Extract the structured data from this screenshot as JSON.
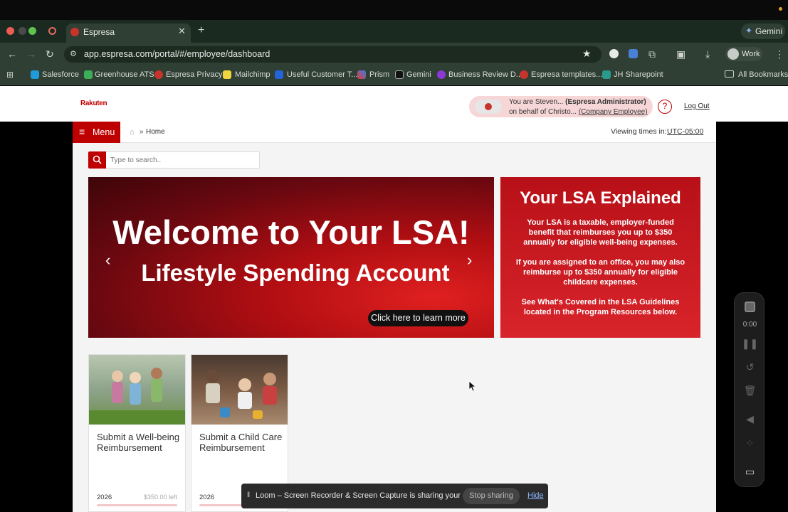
{
  "browser": {
    "tab_title": "Espresa",
    "new_tab": "+",
    "url": "app.espresa.com/portal/#/employee/dashboard",
    "gemini_label": "Gemini",
    "profile_label": "Work",
    "bookmarks": [
      "Salesforce",
      "Greenhouse ATS",
      "Espresa Privacy",
      "Mailchimp",
      "Useful Customer T...",
      "Prism",
      "Gemini",
      "Business Review D...",
      "Espresa templates...",
      "JH Sharepoint"
    ],
    "all_bookmarks": "All Bookmarks"
  },
  "header": {
    "logo": "Rakuten",
    "impersonation": {
      "line1_prefix": "You are Steven...",
      "line1_role": "(Espresa Administrator)",
      "line2_prefix": "on behalf of",
      "line2_name": "Christo...",
      "line2_role": "(Company Employee)"
    },
    "help": "?",
    "logout": "Log Out"
  },
  "nav": {
    "menu_label": "Menu",
    "breadcrumb_sep": "»",
    "breadcrumb_home": "Home",
    "viewing_times_label": "Viewing times in:",
    "timezone": "UTC-05:00"
  },
  "search": {
    "placeholder": "Type to search.."
  },
  "hero": {
    "title": "Welcome to Your LSA!",
    "subtitle": "Lifestyle Spending Account",
    "cta": "Click here to learn more"
  },
  "explained": {
    "title": "Your LSA Explained",
    "p1": "Your LSA is a taxable, employer-funded benefit that reimburses you up to $350 annually for eligible well-being expenses.",
    "p2": "If you are assigned to an office, you may also reimburse up to $350 annually for eligible childcare expenses.",
    "p3": "See What's Covered in the LSA Guidelines located in the Program Resources below."
  },
  "cards": [
    {
      "title": "Submit a Well-being Reimbursement",
      "year": "2026",
      "left": "$350.00 left"
    },
    {
      "title": "Submit a Child Care Reimbursement",
      "year": "2026",
      "left": ""
    }
  ],
  "loom": {
    "message": "Loom – Screen Recorder & Screen Capture is sharing your screen.",
    "stop": "Stop sharing",
    "hide": "Hide",
    "timer": "0:00"
  },
  "colors": {
    "brand_red": "#bf0000",
    "chrome_green": "#2f3f34"
  }
}
